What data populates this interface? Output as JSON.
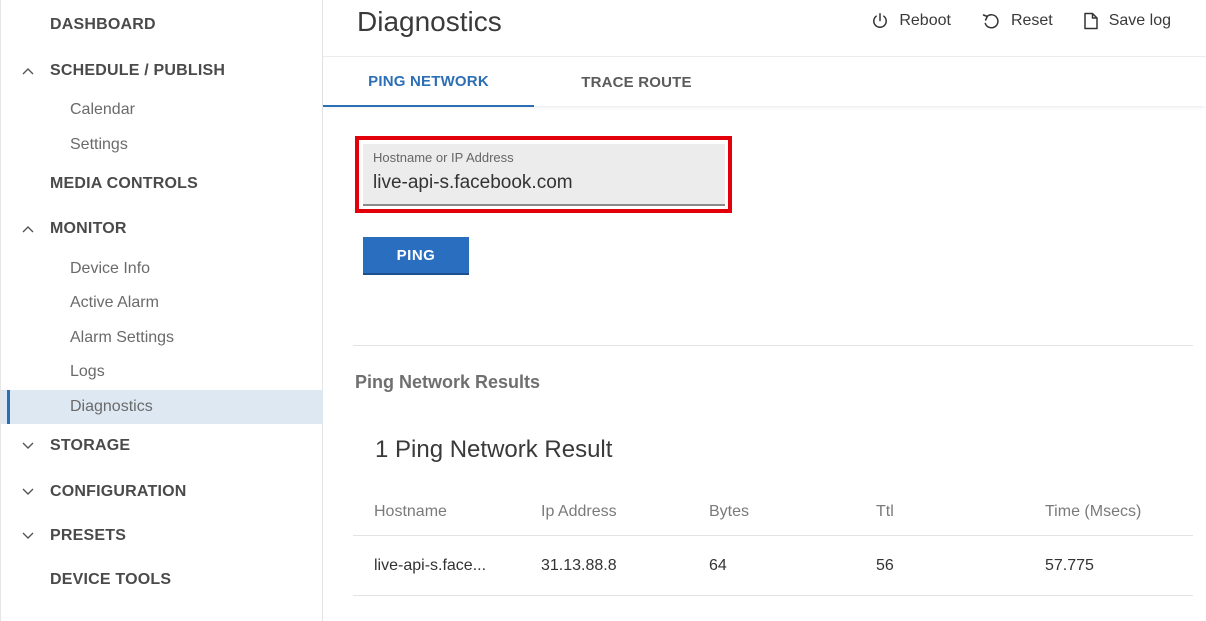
{
  "sidebar": {
    "dashboard": "DASHBOARD",
    "schedule_publish": "SCHEDULE / PUBLISH",
    "calendar": "Calendar",
    "settings": "Settings",
    "media_controls": "MEDIA CONTROLS",
    "monitor": "MONITOR",
    "device_info": "Device Info",
    "active_alarm": "Active Alarm",
    "alarm_settings": "Alarm Settings",
    "logs": "Logs",
    "diagnostics": "Diagnostics",
    "storage": "STORAGE",
    "configuration": "CONFIGURATION",
    "presets": "PRESETS",
    "device_tools": "DEVICE TOOLS"
  },
  "header": {
    "title": "Diagnostics",
    "reboot": "Reboot",
    "reset": "Reset",
    "save_log": "Save log"
  },
  "tabs": {
    "ping_network": "PING NETWORK",
    "trace_route": "TRACE ROUTE"
  },
  "form": {
    "host_label": "Hostname or IP Address",
    "host_value": "live-api-s.facebook.com",
    "ping_button": "PING"
  },
  "results": {
    "heading": "Ping Network Results",
    "count_text": "1 Ping Network Result",
    "columns": {
      "hostname": "Hostname",
      "ip_address": "Ip Address",
      "bytes": "Bytes",
      "ttl": "Ttl",
      "time": "Time (Msecs)"
    },
    "rows": [
      {
        "hostname": "live-api-s.face...",
        "ip_address": "31.13.88.8",
        "bytes": "64",
        "ttl": "56",
        "time": "57.775"
      }
    ]
  },
  "colors": {
    "accent": "#2d6fb5",
    "highlight": "#e4000b",
    "active_nav_bg": "#dde8f3"
  }
}
